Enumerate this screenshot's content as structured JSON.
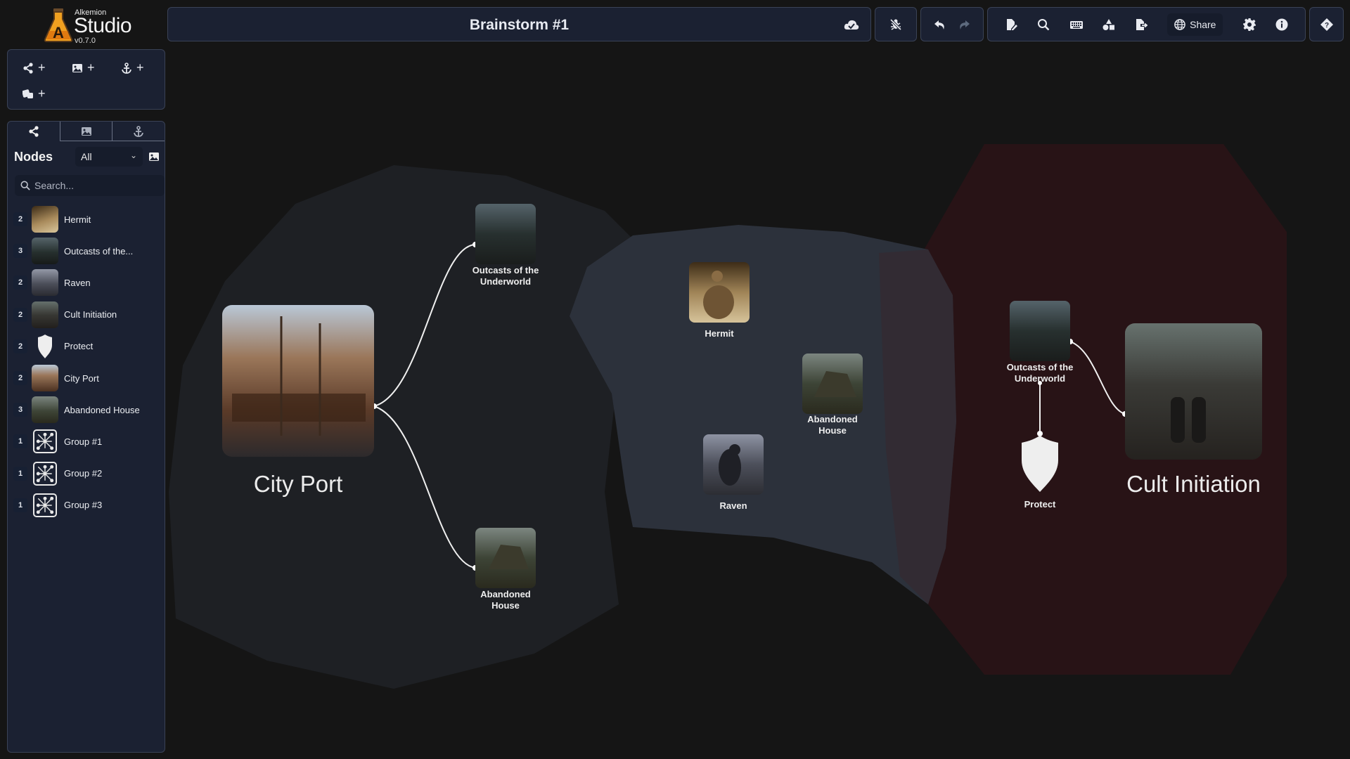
{
  "app": {
    "brand_small": "Alkemion",
    "brand_big": "Studio",
    "version": "v0.7.0"
  },
  "header": {
    "title": "Brainstorm #1",
    "share_label": "Share",
    "icons": [
      "cloud-check-icon",
      "bug-slash-icon",
      "undo-icon",
      "redo-icon",
      "file-edit-icon",
      "search-icon",
      "keyboard-icon",
      "shapes-icon",
      "file-export-icon",
      "globe-icon",
      "gear-icon",
      "info-icon",
      "help-diamond-icon"
    ]
  },
  "actions": [
    {
      "icon": "share-nodes-icon",
      "label": "+"
    },
    {
      "icon": "image-icon",
      "label": "+"
    },
    {
      "icon": "anchor-icon",
      "label": "+"
    },
    {
      "icon": "dice-icon",
      "label": "+"
    }
  ],
  "sidebar": {
    "tabs": [
      "nodes-tab",
      "images-tab",
      "anchors-tab"
    ],
    "heading": "Nodes",
    "filter_value": "All",
    "search_placeholder": "Search...",
    "items": [
      {
        "count": "2",
        "label": "Hermit",
        "thumb": "hermit"
      },
      {
        "count": "3",
        "label": "Outcasts of the...",
        "thumb": "outcasts"
      },
      {
        "count": "2",
        "label": "Raven",
        "thumb": "raven"
      },
      {
        "count": "2",
        "label": "Cult Initiation",
        "thumb": "cult"
      },
      {
        "count": "2",
        "label": "Protect",
        "thumb": "shield"
      },
      {
        "count": "2",
        "label": "City Port",
        "thumb": "port"
      },
      {
        "count": "3",
        "label": "Abandoned House",
        "thumb": "house"
      },
      {
        "count": "1",
        "label": "Group #1",
        "thumb": "group"
      },
      {
        "count": "1",
        "label": "Group #2",
        "thumb": "group"
      },
      {
        "count": "1",
        "label": "Group #3",
        "thumb": "group"
      }
    ]
  },
  "canvas": {
    "nodes": {
      "city_port": "City Port",
      "outcasts_left_1": "Outcasts of the",
      "outcasts_left_2": "Underworld",
      "house_left_1": "Abandoned",
      "house_left_2": "House",
      "hermit": "Hermit",
      "house_mid_1": "Abandoned",
      "house_mid_2": "House",
      "raven": "Raven",
      "outcasts_right_1": "Outcasts of the",
      "outcasts_right_2": "Underworld",
      "protect": "Protect",
      "cult": "Cult Initiation"
    },
    "colors": {
      "group1": "#1f2126",
      "group2": "#2c313b",
      "group3": "#2a1215",
      "edge": "#f0f0f0"
    }
  }
}
